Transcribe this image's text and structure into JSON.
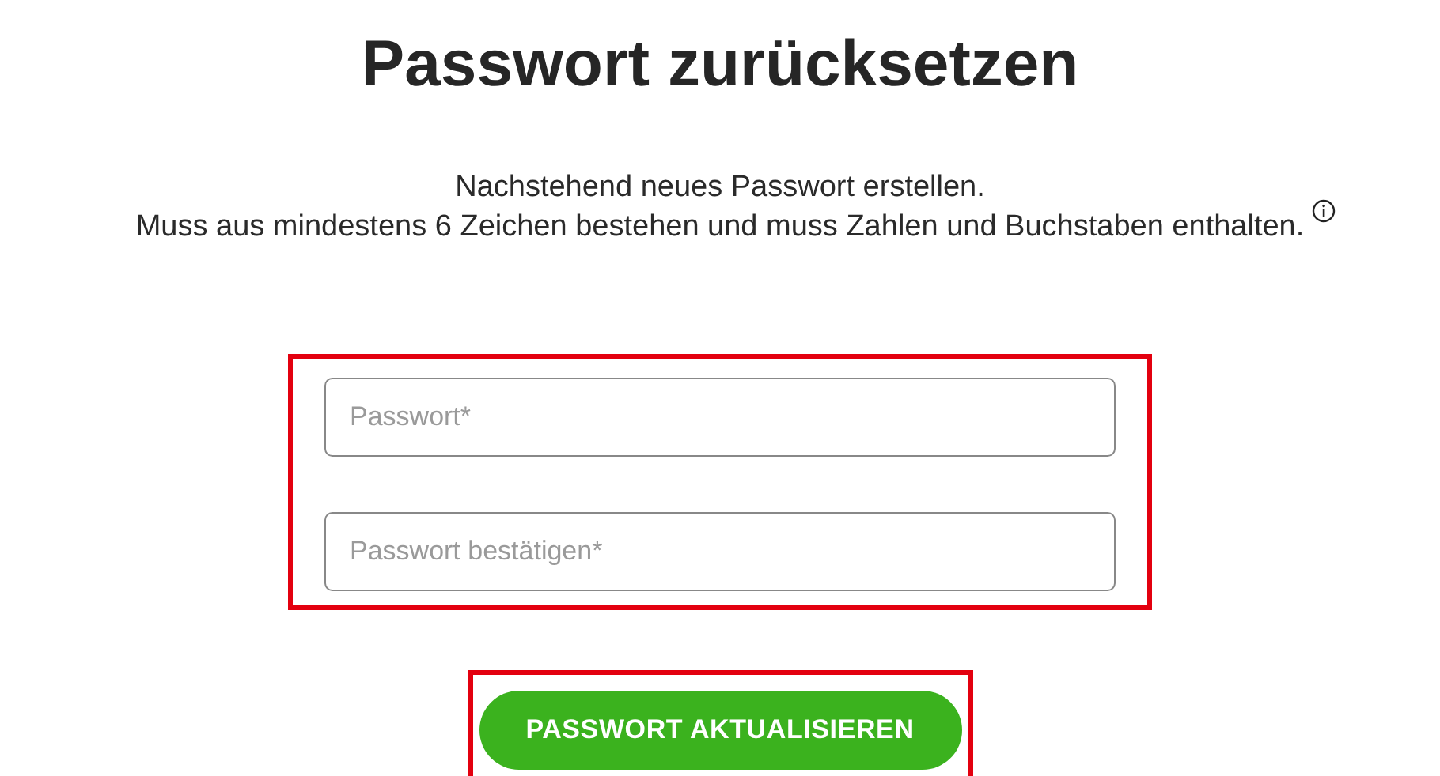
{
  "title": "Passwort zurücksetzen",
  "description": [
    "Nachstehend neues Passwort erstellen.",
    "Muss aus mindestens 6 Zeichen bestehen und muss Zahlen und Buchstaben enthalten."
  ],
  "fields": [
    {
      "placeholder": "Passwort*"
    },
    {
      "placeholder": "Passwort bestätigen*"
    }
  ],
  "submit_button": {
    "label": "PASSWORT AKTUALISIEREN"
  }
}
